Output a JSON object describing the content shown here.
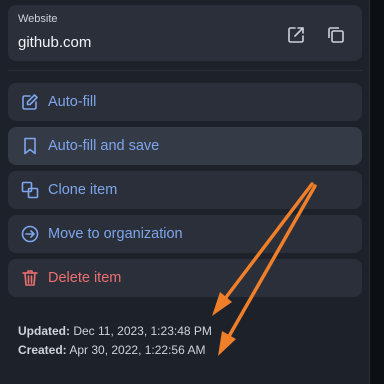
{
  "website": {
    "label": "Website",
    "value": "github.com",
    "launch_icon": "launch-icon",
    "copy_icon": "copy-icon"
  },
  "actions": [
    {
      "label": "Auto-fill",
      "icon": "pencil-square-icon"
    },
    {
      "label": "Auto-fill and save",
      "icon": "bookmark-icon"
    },
    {
      "label": "Clone item",
      "icon": "clone-icon"
    },
    {
      "label": "Move to organization",
      "icon": "arrow-circle-right-icon"
    },
    {
      "label": "Delete item",
      "icon": "trash-icon"
    }
  ],
  "meta": {
    "updated_label": "Updated:",
    "updated_value": "Dec 11, 2023, 1:23:48 PM",
    "created_label": "Created:",
    "created_value": "Apr 30, 2022, 1:22:56 AM"
  },
  "colors": {
    "panel_bg": "#1d2129",
    "card_bg": "#2a2f39",
    "accent": "#7ea6ec",
    "danger": "#ef6f6f",
    "annotation_arrow": "#f07f2a"
  }
}
